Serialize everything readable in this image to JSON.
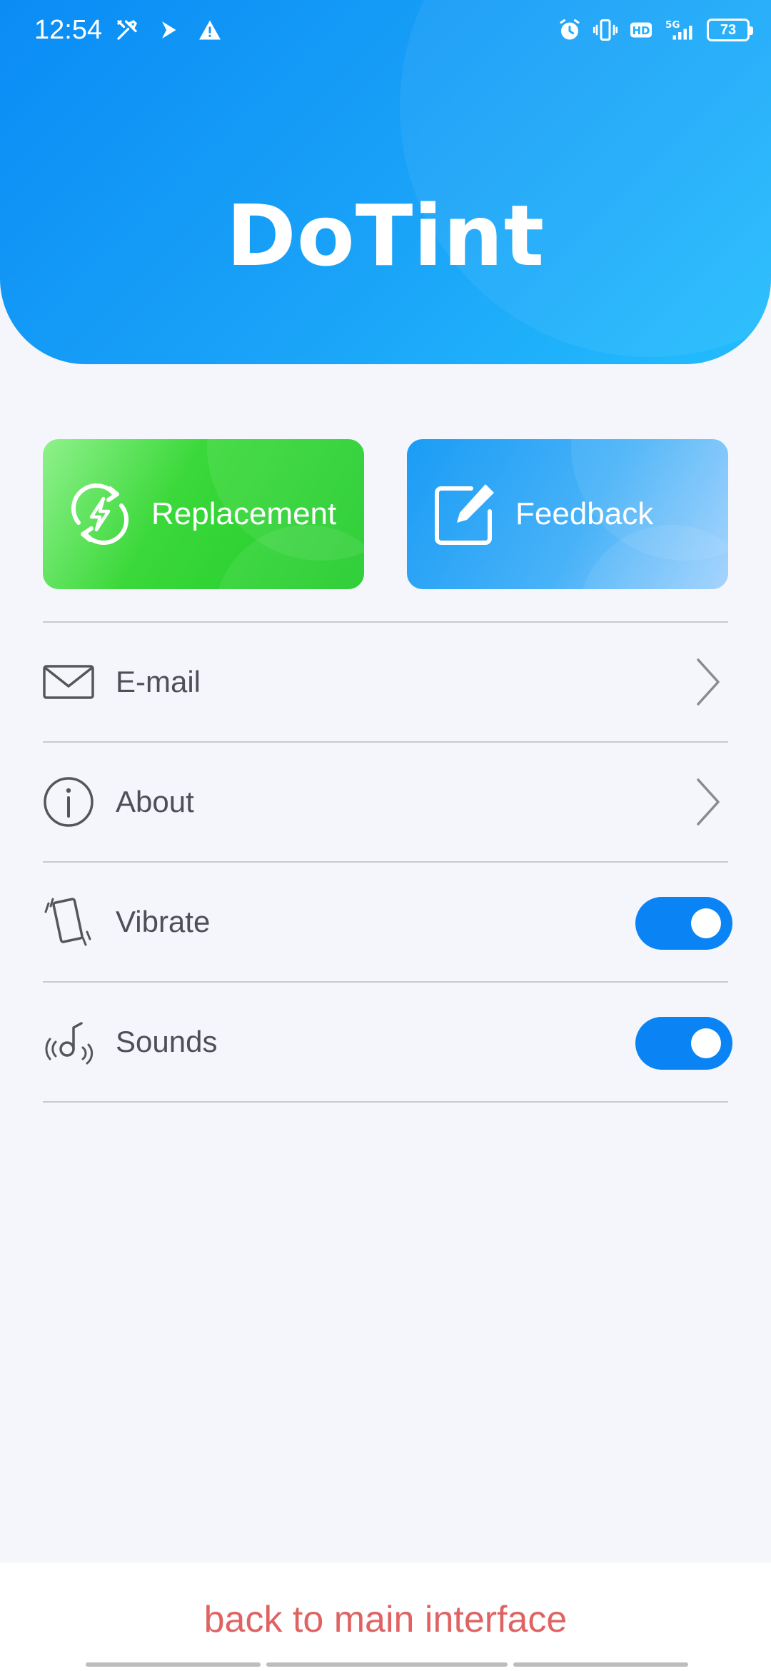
{
  "status_bar": {
    "time": "12:54",
    "left_icons": [
      "tools-icon",
      "location-arrow-icon",
      "warning-icon"
    ],
    "right_icons": [
      "alarm-icon",
      "vibrate-mode-icon",
      "hd-icon",
      "5g-signal-icon"
    ],
    "hd_label": "HD",
    "network_label": "5G",
    "battery_level": "73"
  },
  "header": {
    "app_title": "DoTint",
    "background_colors": [
      "#0a8cf5",
      "#23bdfd"
    ]
  },
  "quick_actions": {
    "replacement": {
      "label": "Replacement",
      "icon": "refresh-bolt-icon",
      "color": "#2fd32f"
    },
    "feedback": {
      "label": "Feedback",
      "icon": "edit-note-icon",
      "color": "#3aaaf7"
    }
  },
  "settings": {
    "items": [
      {
        "label": "E-mail",
        "icon": "envelope-icon",
        "control": "chevron"
      },
      {
        "label": "About",
        "icon": "info-circle-icon",
        "control": "chevron"
      },
      {
        "label": "Vibrate",
        "icon": "vibrate-phone-icon",
        "control": "toggle",
        "on": true
      },
      {
        "label": "Sounds",
        "icon": "sound-note-icon",
        "control": "toggle",
        "on": true
      }
    ],
    "toggle_color": "#0a84f5"
  },
  "footer": {
    "back_label": "back to main interface",
    "back_color": "#e06363"
  }
}
